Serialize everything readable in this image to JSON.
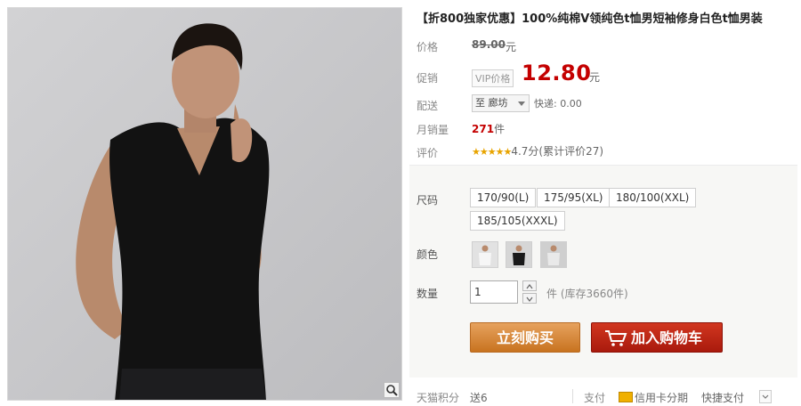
{
  "product": {
    "title": "【折800独家优惠】100%纯棉V领纯色t恤男短袖修身白色t恤男装",
    "labels": {
      "price": "价格",
      "promo": "促销",
      "delivery": "配送",
      "monthly_sales": "月销量",
      "rating": "评价",
      "size": "尺码",
      "color": "颜色",
      "quantity": "数量",
      "points": "天猫积分",
      "payment": "支付"
    },
    "original_price": "89.00",
    "currency_unit": "元",
    "vip_tag": "VIP价格",
    "promo_price": "12.80",
    "location": "至 廊坊",
    "shipping": "快递: 0.00",
    "sales_count": "271",
    "sales_unit": "件",
    "stars": "★★★★★",
    "rating_text": "4.7分(累计评价27)",
    "rating_score": 4.7
  },
  "sizes": [
    "170/90(L)",
    "175/95(XL)",
    "180/100(XXL)",
    "185/105(XXXL)"
  ],
  "colors": [
    {
      "name": "white-shirt-swatch",
      "shirt": "#f2f2f2"
    },
    {
      "name": "black-shirt-swatch",
      "shirt": "#1a1a1a"
    },
    {
      "name": "grey-shirt-swatch",
      "shirt": "#d4d4d4"
    }
  ],
  "quantity": {
    "value": "1",
    "stock_text": "件 (库存3660件)"
  },
  "buttons": {
    "buy_now": "立刻购买",
    "add_to_cart": "加入购物车"
  },
  "footer": {
    "points_value": "送6",
    "credit_installment": "信用卡分期",
    "quick_pay": "快捷支付"
  },
  "theme": {
    "price_red": "#c40000",
    "buy_orange": "#d98a3e",
    "cart_red": "#c0281a"
  }
}
